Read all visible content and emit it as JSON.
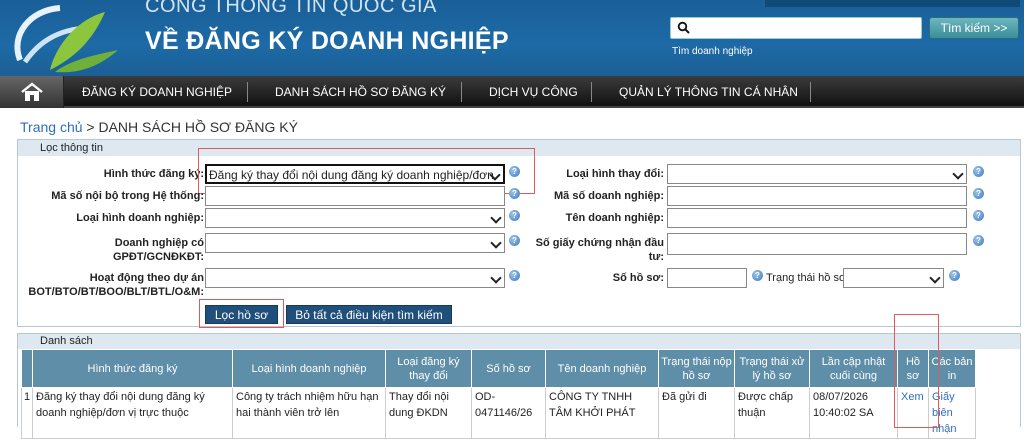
{
  "header": {
    "brand_top": "CỔNG THÔNG TIN QUỐC GIA",
    "brand_main": "VỀ ĐĂNG KÝ DOANH NGHIỆP",
    "search_hint": "Tìm doanh nghiệp",
    "search_value": "",
    "search_button": "Tìm kiếm >>"
  },
  "nav": {
    "items": [
      "ĐĂNG KÝ DOANH NGHIỆP",
      "DANH SÁCH HỒ SƠ ĐĂNG KÝ",
      "DỊCH VỤ CÔNG",
      "QUẢN LÝ THÔNG TIN CÁ NHÂN"
    ]
  },
  "breadcrumb": {
    "home": "Trang chủ",
    "sep": ">",
    "current": "DANH SÁCH HỒ SƠ ĐĂNG KÝ"
  },
  "filter": {
    "title": "Lọc thông tin",
    "hinh_thuc_label": "Hình thức đăng ký:",
    "hinh_thuc_value": "Đăng ký thay đổi nội dung đăng ký doanh nghiệp/đơn",
    "loai_thay_doi_label": "Loại hình thay đổi:",
    "loai_thay_doi_value": "",
    "ma_noi_bo_label": "Mã số nội bộ trong Hệ thống:",
    "ma_noi_bo_value": "",
    "ma_dn_label": "Mã số doanh nghiệp:",
    "ma_dn_value": "",
    "loai_hinh_label": "Loại hình doanh nghiệp:",
    "loai_hinh_value": "",
    "ten_dn_label": "Tên doanh nghiệp:",
    "ten_dn_value": "",
    "gpdt_label_1": "Doanh nghiệp có",
    "gpdt_label_2": "GPĐT/GCNĐKĐT:",
    "gpdt_value": "",
    "so_giay_label_1": "Số giấy chứng nhận đầu",
    "so_giay_label_2": "tư:",
    "so_giay_value": "",
    "du_an_label_1": "Hoạt động theo dự án",
    "du_an_label_2": "BOT/BTO/BT/BOO/BLT/BTL/O&M:",
    "du_an_value": "",
    "so_ho_so_label": "Số hồ sơ:",
    "so_ho_so_value": "",
    "trang_thai_label": "Trạng thái hồ sơ",
    "trang_thai_value": "",
    "filter_button": "Lọc hồ sơ",
    "clear_button": "Bỏ tất cả điều kiện tìm kiếm"
  },
  "list": {
    "title": "Danh sách",
    "columns": [
      "",
      "Hình thức đăng ký",
      "Loại hình doanh nghiệp",
      "Loại đăng ký thay đổi",
      "Số hồ sơ",
      "Tên doanh nghiệp",
      "Trạng thái nộp hồ sơ",
      "Trạng thái xử lý hồ sơ",
      "Lần cập nhật cuối cùng",
      "Hồ sơ",
      "Các bản in"
    ],
    "rows": [
      {
        "no": "1",
        "hinh_thuc": "Đăng ký thay đổi nội dung đăng ký doanh nghiệp/đơn vị trực thuộc",
        "loai_hinh": "Công ty trách nhiệm hữu hạn hai thành viên trở lên",
        "loai_dk": "Thay đổi nội dung ĐKDN",
        "so_ho_so": "OD-0471146/26",
        "ten_dn": "CÔNG TY TNHH TÂM KHỞI PHÁT",
        "tt_nop": "Đã gửi đi",
        "tt_xuly": "Được chấp thuận",
        "cap_nhat": "08/07/2026 10:40:02 SA",
        "ho_so": "Xem",
        "ban_in": "Giấy biên nhận"
      }
    ]
  }
}
